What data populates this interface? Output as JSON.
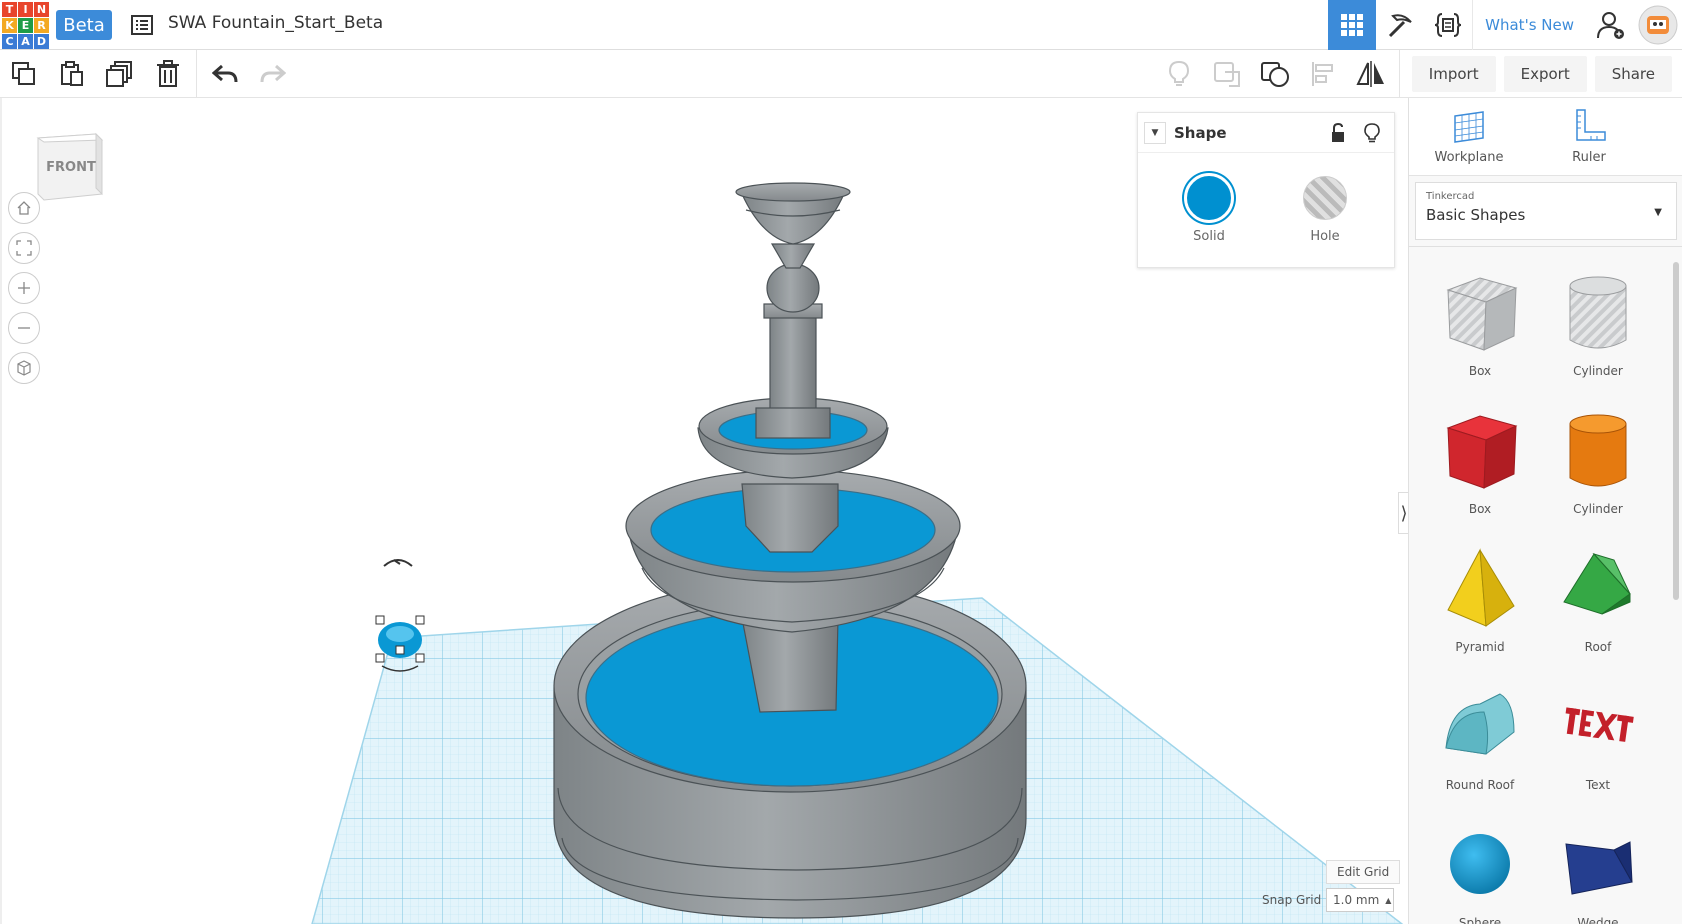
{
  "app": {
    "logo_letters": [
      "T",
      "I",
      "N",
      "K",
      "E",
      "R",
      "C",
      "A",
      "D"
    ],
    "logo_colors": [
      "#e8452c",
      "#e8452c",
      "#e8452c",
      "#f3a923",
      "#1f9c48",
      "#f3a923",
      "#3a7bd5",
      "#3a7bd5",
      "#3a7bd5"
    ],
    "beta_label": "Beta",
    "document_title": "SWA Fountain_Start_Beta"
  },
  "header": {
    "whats_new": "What's New",
    "buttons": [
      {
        "name": "3d-design-view",
        "icon": "grid-icon",
        "active": true
      },
      {
        "name": "blocks-view",
        "icon": "pickaxe-icon",
        "active": false
      },
      {
        "name": "codeblocks-view",
        "icon": "code-braces-icon",
        "active": false
      }
    ]
  },
  "toolbar": {
    "left_tools": [
      "copy-icon",
      "paste-icon",
      "duplicate-icon",
      "trash-icon",
      "undo-icon",
      "redo-icon"
    ],
    "right_tools": [
      "lightbulb-icon",
      "group-icon",
      "ungroup-icon",
      "align-icon",
      "mirror-icon"
    ],
    "import_label": "Import",
    "export_label": "Export",
    "share_label": "Share"
  },
  "viewport": {
    "viewcube_face": "FRONT",
    "nav_buttons": [
      "home-icon",
      "fit-icon",
      "zoom-in-icon",
      "zoom-out-icon",
      "perspective-icon"
    ],
    "edit_grid_label": "Edit Grid",
    "snap_grid_label": "Snap Grid",
    "snap_grid_value": "1.0 mm",
    "water_color": "#0a98d4",
    "stone_color": "#8e9396",
    "grid_color": "#9fd5ea"
  },
  "shape_panel": {
    "title": "Shape",
    "solid_label": "Solid",
    "hole_label": "Hole",
    "solid_color": "#0090d0"
  },
  "sidebar": {
    "workplane_label": "Workplane",
    "ruler_label": "Ruler",
    "library_provider": "Tinkercad",
    "library_name": "Basic Shapes",
    "shapes": [
      {
        "label": "Box"
      },
      {
        "label": "Cylinder"
      },
      {
        "label": "Box"
      },
      {
        "label": "Cylinder"
      },
      {
        "label": "Pyramid"
      },
      {
        "label": "Roof"
      },
      {
        "label": "Round Roof"
      },
      {
        "label": "Text"
      },
      {
        "label": "Sphere"
      },
      {
        "label": "Wedge"
      }
    ]
  }
}
